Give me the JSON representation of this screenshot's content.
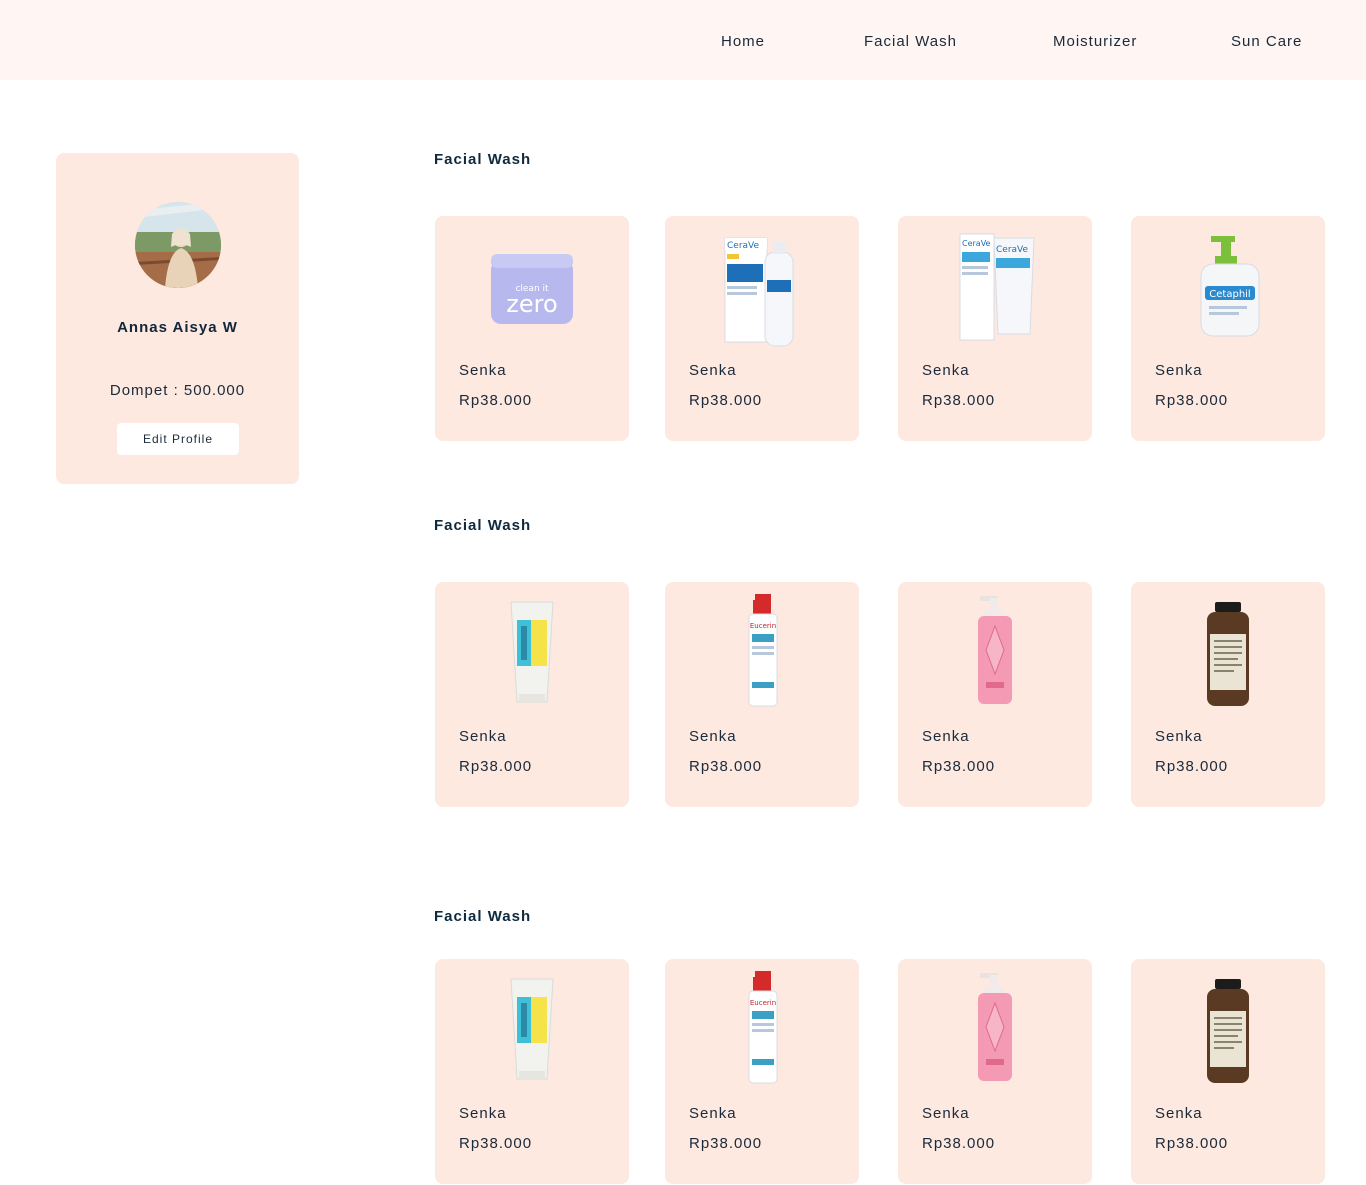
{
  "nav": {
    "items": [
      "Home",
      "Facial Wash",
      "Moisturizer",
      "Sun Care"
    ]
  },
  "profile": {
    "name": "Annas Aisya W",
    "wallet": "Dompet : 500.000",
    "edit_label": "Edit Profile"
  },
  "sections": [
    {
      "title": "Facial Wash",
      "products": [
        {
          "name": "Senka",
          "price": "Rp38.000",
          "icon": "cleansing-balm-jar"
        },
        {
          "name": "Senka",
          "price": "Rp38.000",
          "icon": "moisturizing-lotion-box"
        },
        {
          "name": "Senka",
          "price": "Rp38.000",
          "icon": "cream-tubes"
        },
        {
          "name": "Senka",
          "price": "Rp38.000",
          "icon": "pump-bottle-white"
        }
      ]
    },
    {
      "title": "Facial Wash",
      "products": [
        {
          "name": "Senka",
          "price": "Rp38.000",
          "icon": "cleanser-tube"
        },
        {
          "name": "Senka",
          "price": "Rp38.000",
          "icon": "lotion-pump-red"
        },
        {
          "name": "Senka",
          "price": "Rp38.000",
          "icon": "pink-pump-bottle"
        },
        {
          "name": "Senka",
          "price": "Rp38.000",
          "icon": "brown-toner-bottle"
        }
      ]
    },
    {
      "title": "Facial Wash",
      "products": [
        {
          "name": "Senka",
          "price": "Rp38.000",
          "icon": "cleanser-tube"
        },
        {
          "name": "Senka",
          "price": "Rp38.000",
          "icon": "lotion-pump-red"
        },
        {
          "name": "Senka",
          "price": "Rp38.000",
          "icon": "pink-pump-bottle"
        },
        {
          "name": "Senka",
          "price": "Rp38.000",
          "icon": "brown-toner-bottle"
        }
      ]
    }
  ],
  "colors": {
    "nav_bg": "#fff6f3",
    "card_bg": "#fde9e0",
    "text": "#1b2a3a"
  }
}
